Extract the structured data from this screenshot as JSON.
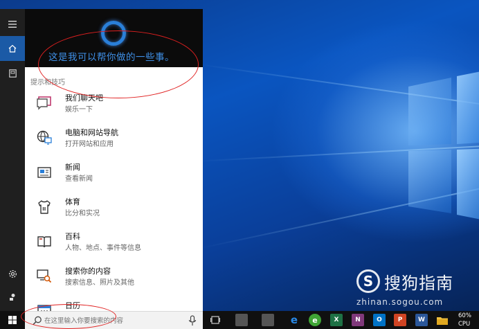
{
  "panel": {
    "greeting": "这是我可以帮你做的一些事。",
    "section_title": "提示和技巧",
    "items": [
      {
        "title": "我们聊天吧",
        "subtitle": "娱乐一下",
        "icon": "chat-bubble-icon"
      },
      {
        "title": "电脑和网站导航",
        "subtitle": "打开网站和应用",
        "icon": "globe-monitor-icon"
      },
      {
        "title": "新闻",
        "subtitle": "查看新闻",
        "icon": "newspaper-icon"
      },
      {
        "title": "体育",
        "subtitle": "比分和实况",
        "icon": "jersey-icon"
      },
      {
        "title": "百科",
        "subtitle": "人物、地点、事件等信息",
        "icon": "book-icon"
      },
      {
        "title": "搜索你的内容",
        "subtitle": "搜索信息、照片及其他",
        "icon": "search-content-icon"
      },
      {
        "title": "日历",
        "subtitle": "",
        "icon": "calendar-icon"
      }
    ]
  },
  "search": {
    "placeholder": "在这里输入你要搜索的内容"
  },
  "taskbar": {
    "icons": [
      {
        "name": "task-view-icon",
        "label": ""
      },
      {
        "name": "app-icon",
        "label": ""
      },
      {
        "name": "app-icon-2",
        "label": ""
      },
      {
        "name": "edge-icon",
        "label": "e"
      },
      {
        "name": "browser-360-icon",
        "label": "e"
      },
      {
        "name": "excel-icon",
        "label": "X"
      },
      {
        "name": "onenote-icon",
        "label": "N"
      },
      {
        "name": "outlook-icon",
        "label": "O"
      },
      {
        "name": "powerpoint-icon",
        "label": "P"
      },
      {
        "name": "word-icon",
        "label": "W"
      },
      {
        "name": "file-explorer-icon",
        "label": ""
      }
    ],
    "tray": {
      "line1": "60%",
      "line2": "CPU"
    }
  },
  "watermark": {
    "logo": "S",
    "text": "搜狗指南",
    "url": "zhinan.sogou.com"
  },
  "colors": {
    "accent": "#1b5aa6",
    "greeting": "#3f8fe6",
    "annotation": "#e02020"
  }
}
